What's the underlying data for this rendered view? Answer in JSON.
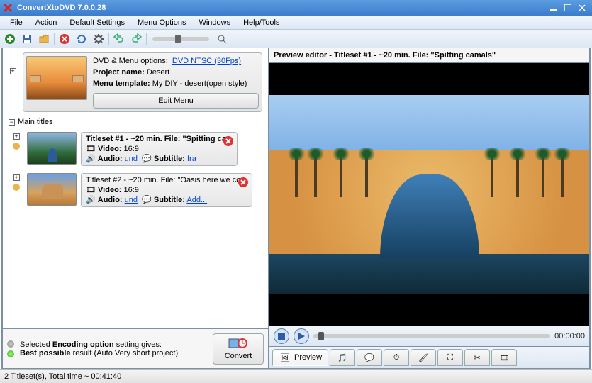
{
  "titlebar": {
    "app_title": "ConvertXtoDVD 7.0.0.28"
  },
  "menu": {
    "file": "File",
    "action": "Action",
    "default_settings": "Default Settings",
    "menu_options": "Menu Options",
    "windows": "Windows",
    "help": "Help/Tools"
  },
  "dvdopts": {
    "label": "DVD & Menu options:",
    "link": "DVD NTSC (30Fps)",
    "project_label": "Project name:",
    "project_value": "Desert",
    "template_label": "Menu template:",
    "template_value": "My  DIY - desert(open style)",
    "edit_btn": "Edit Menu"
  },
  "tree": {
    "main_titles": "Main titles"
  },
  "titlesets": [
    {
      "header": "Titleset #1 - ~20 min. File: \"Spitting ca...",
      "video_label": "Video:",
      "video_val": "16:9",
      "audio_label": "Audio:",
      "audio_link": "und",
      "subtitle_label": "Subtitle:",
      "subtitle_link": "fra"
    },
    {
      "header": "Titleset #2 - ~20 min. File: \"Oasis here we co...",
      "video_label": "Video:",
      "video_val": "16:9",
      "audio_label": "Audio:",
      "audio_link": "und",
      "subtitle_label": "Subtitle:",
      "subtitle_link": "Add..."
    }
  ],
  "encoding": {
    "line1a": "Selected ",
    "line1b": "Encoding option",
    "line1c": " setting gives:",
    "line2a": "Best possible",
    "line2b": " result (Auto Very short project)"
  },
  "convert_btn": "Convert",
  "preview": {
    "header": "Preview editor - Titleset #1 - ~20 min. File: \"Spitting camals\"",
    "time": "00:00:00"
  },
  "tabs": {
    "preview": "Preview"
  },
  "statusbar": "2 Titleset(s), Total time ~ 00:41:40"
}
